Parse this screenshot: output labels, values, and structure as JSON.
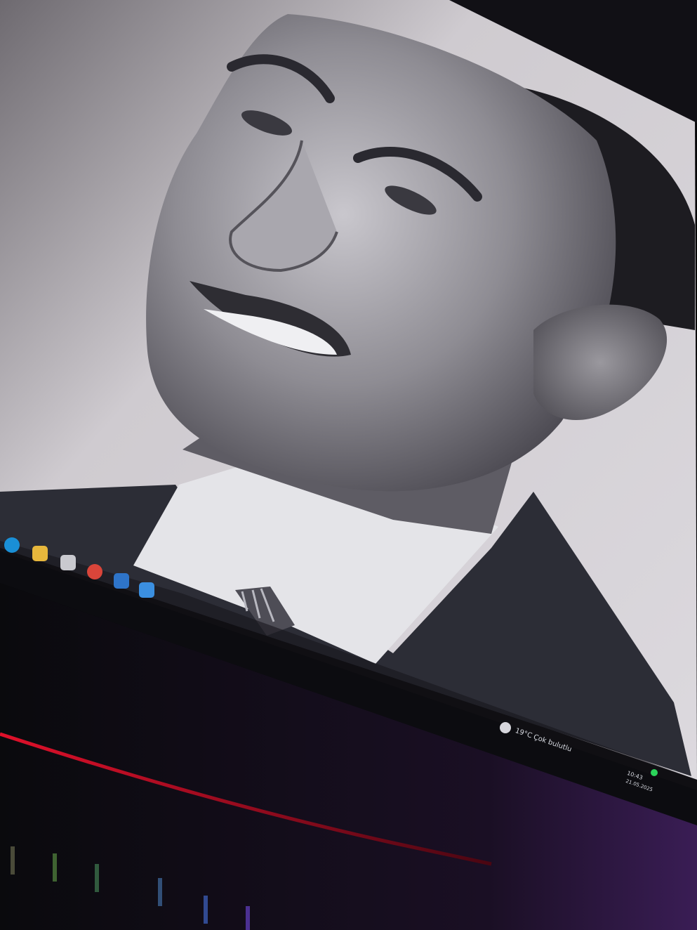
{
  "photo": {
    "subject": "smiling-man-portrait",
    "style": "black-and-white",
    "colors": {
      "background": "#d8d6da",
      "skin_mid": "#8f8d93",
      "suit": "#2c2d36",
      "shirt": "#e6e6ea",
      "hair": "#1d1c21"
    }
  },
  "taskbar": {
    "pinned_apps": [
      {
        "name": "edge",
        "icon": "edge-icon",
        "color": "#1a8fd6"
      },
      {
        "name": "file-explorer",
        "icon": "folder-icon",
        "color": "#e7b73c"
      },
      {
        "name": "store",
        "icon": "store-icon",
        "color": "#c9c9cf"
      },
      {
        "name": "chrome",
        "icon": "chrome-icon",
        "color": "#d9453a"
      },
      {
        "name": "mail",
        "icon": "mail-icon",
        "color": "#2e74c9"
      },
      {
        "name": "photos",
        "icon": "photos-icon",
        "color": "#3b8fe0"
      }
    ],
    "weather": {
      "icon": "weather-icon",
      "temp": "19°C",
      "desc": "Çok bulutlu"
    },
    "tray": {
      "time": "10:43",
      "date": "21.05.2025"
    }
  },
  "ambient": {
    "led_color": "#c01428",
    "indicator_color": "#2bd45a"
  }
}
